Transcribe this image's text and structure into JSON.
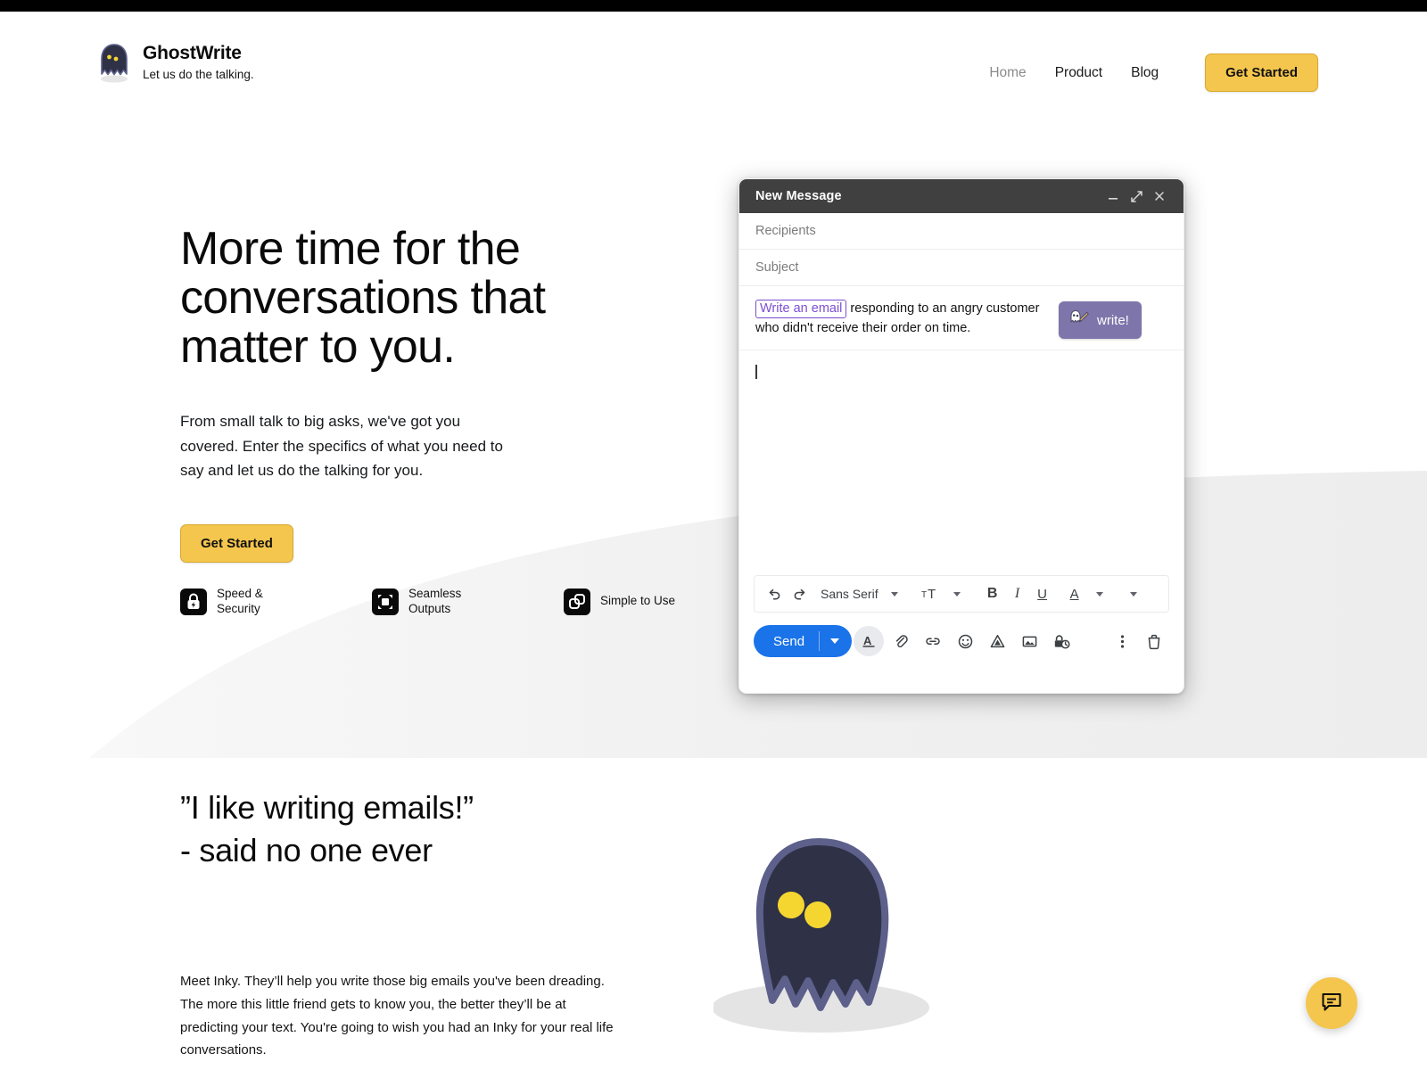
{
  "brand": {
    "name": "GhostWrite",
    "tagline": "Let us do the talking.",
    "logo_icon": "ghost-icon"
  },
  "nav": {
    "links": [
      {
        "label": "Home",
        "state": "muted"
      },
      {
        "label": "Product",
        "state": "default"
      },
      {
        "label": "Blog",
        "state": "default"
      }
    ],
    "cta_label": "Get Started"
  },
  "hero": {
    "heading": "More time for the conversations that matter to you.",
    "paragraph": "From small talk to big asks, we've got you covered. Enter the specifics of what you need to say and let us do the talking for you.",
    "cta_label": "Get Started",
    "features": [
      {
        "label": "Speed & Security",
        "icon": "lock-bolt-icon"
      },
      {
        "label": "Seamless Outputs",
        "icon": "expand-frame-icon"
      },
      {
        "label": "Simple to Use",
        "icon": "overlapping-squares-icon"
      }
    ]
  },
  "compose": {
    "title": "New Message",
    "window_controls": [
      {
        "name": "minimize-icon",
        "glyph": "—"
      },
      {
        "name": "expand-icon",
        "glyph": "⤢"
      },
      {
        "name": "close-icon",
        "glyph": "✕"
      }
    ],
    "recipients_placeholder": "Recipients",
    "subject_placeholder": "Subject",
    "prompt": {
      "chip": "Write an email",
      "rest": " responding to an angry customer who didn't receive their order on time."
    },
    "write_button_label": "write!",
    "write_button_icon": "ghost-pencil-icon",
    "body_value": "",
    "format_toolbar": {
      "undo": "undo-icon",
      "redo": "redo-icon",
      "font_name": "Sans Serif",
      "size": "text-size-icon",
      "bold": "B",
      "italic": "I",
      "underline": "U",
      "text_color": "A",
      "more": "more-format-icon"
    },
    "send_label": "Send",
    "actions": [
      {
        "name": "formatting-options-icon",
        "glyph": "A"
      },
      {
        "name": "attach-file-icon",
        "glyph": "paperclip"
      },
      {
        "name": "insert-link-icon",
        "glyph": "link"
      },
      {
        "name": "insert-emoji-icon",
        "glyph": "smiley"
      },
      {
        "name": "insert-drive-icon",
        "glyph": "drive"
      },
      {
        "name": "insert-photo-icon",
        "glyph": "image"
      },
      {
        "name": "confidential-mode-icon",
        "glyph": "lock-clock"
      },
      {
        "name": "more-options-icon",
        "glyph": "⋮"
      },
      {
        "name": "discard-draft-icon",
        "glyph": "trash"
      }
    ]
  },
  "section_two": {
    "quote_line1": "”I like writing emails!”",
    "quote_line2": "- said no one ever",
    "paragraph": "Meet Inky. They’ll help you write those big emails you've been dreading. The more this little friend gets to know you, the better they’ll be at predicting your text. You're going to wish you had an Inky for your real life conversations.",
    "mascot_icon": "ghost-mascot"
  },
  "fab": {
    "icon": "chat-bubble-icon"
  },
  "colors": {
    "accent_yellow": "#f4c64d",
    "send_blue": "#1a73e8",
    "write_purple": "#7e76ab",
    "chip_purple": "#7b4fd1",
    "ghost_body": "#2f3147",
    "ghost_outline": "#5d608a",
    "ghost_eye": "#f5d631",
    "compose_bar": "#404040",
    "top_bar": "#000000"
  }
}
